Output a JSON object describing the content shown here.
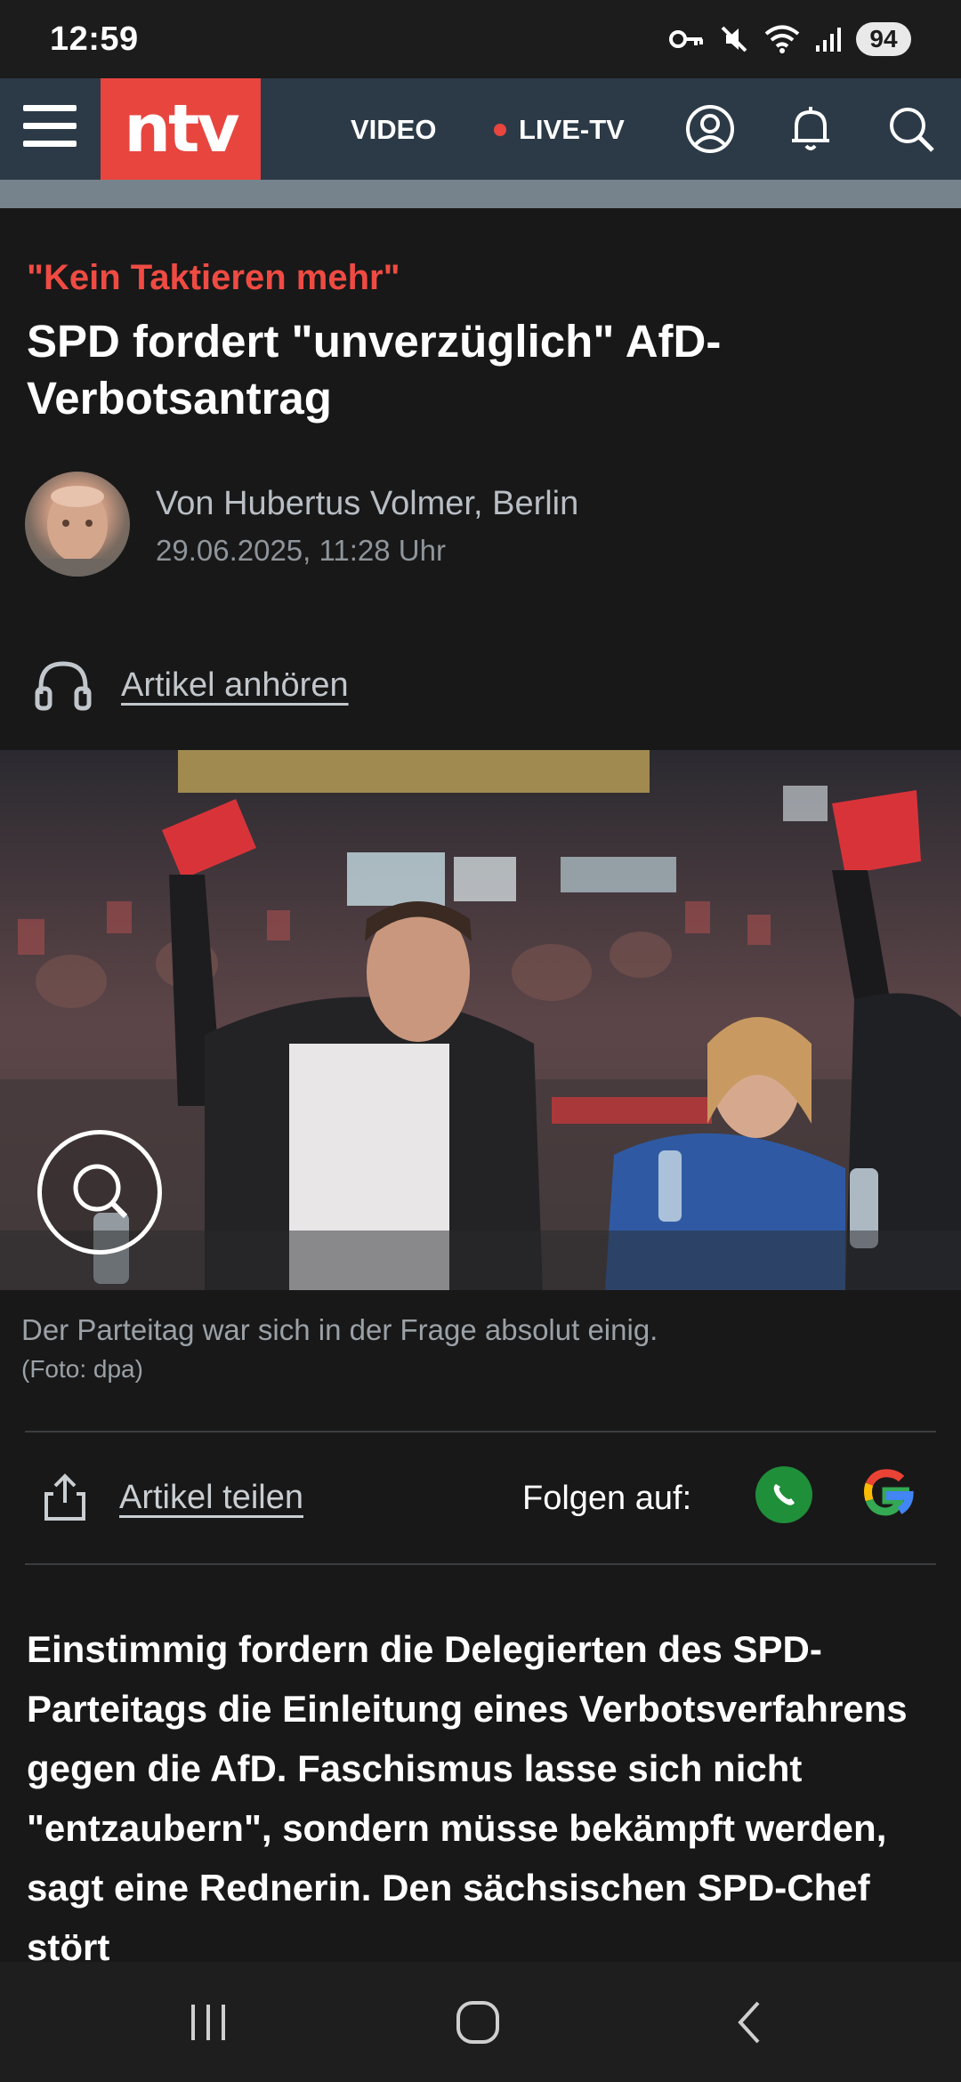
{
  "status_bar": {
    "time": "12:59",
    "battery": "94",
    "icons": [
      "key-icon",
      "mute-icon",
      "wifi-icon",
      "signal-icon"
    ]
  },
  "navbar": {
    "logo_text": "ntv",
    "video_label": "VIDEO",
    "live_label": "LIVE-TV",
    "colors": {
      "bar": "#2c3a47",
      "brand": "#e8453f"
    }
  },
  "article": {
    "kicker": "\"Kein Taktieren mehr\"",
    "headline": "SPD fordert \"unverzüglich\" AfD-Verbotsantrag",
    "author": "Von Hubertus Volmer, Berlin",
    "date": "29.06.2025, 11:28 Uhr",
    "listen_label": "Artikel anhören",
    "photo_caption": "Der Parteitag war sich in der Frage absolut einig.",
    "photo_credit": "(Foto: dpa)",
    "share_label": "Artikel teilen",
    "follow_label": "Folgen auf:",
    "lead": "Einstimmig fordern die Delegierten des SPD-Parteitags die Einleitung eines Verbotsverfahrens gegen die AfD. Faschismus lasse sich nicht \"entzaubern\", sondern müsse bekämpft werden, sagt eine Rednerin. Den sächsischen SPD-Chef stört"
  }
}
